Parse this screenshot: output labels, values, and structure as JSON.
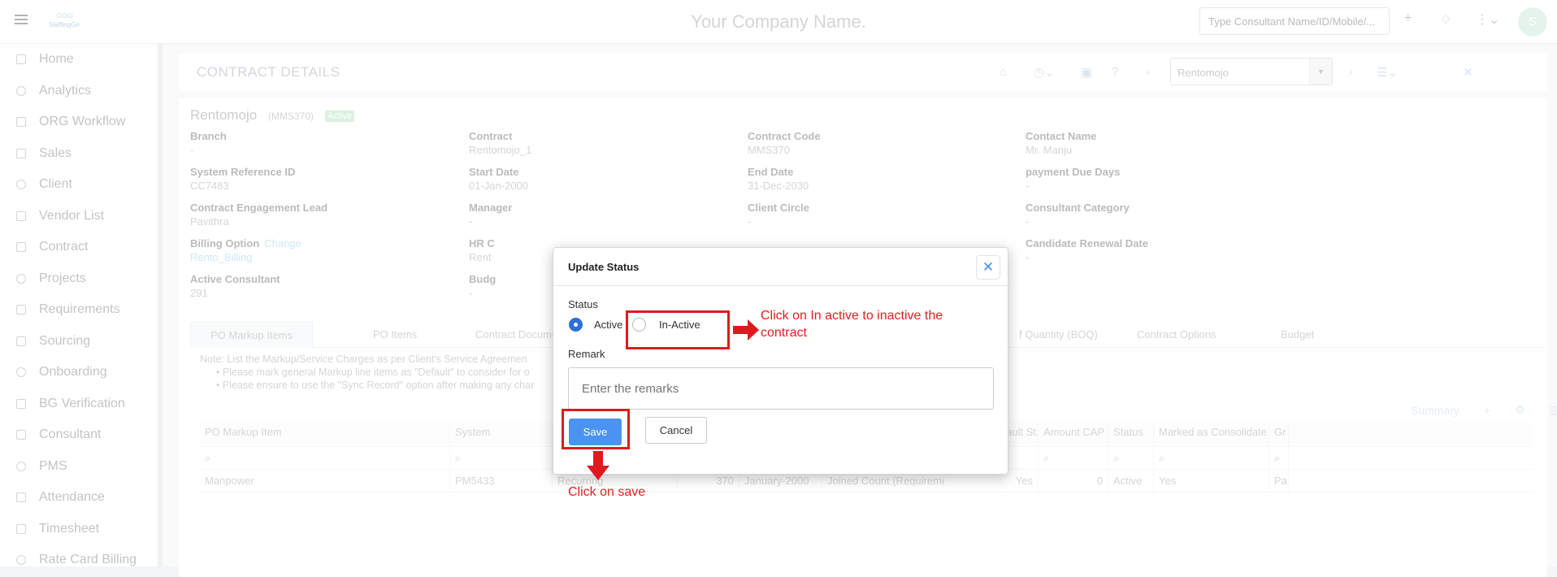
{
  "topbar": {
    "logo_text": "StaffingGo",
    "company_name": "Your Company Name.",
    "search_placeholder": "Type Consultant Name/ID/Mobile/...",
    "avatar_initial": "S"
  },
  "sidebar": {
    "items": [
      {
        "label": "Home",
        "icon": "home-icon"
      },
      {
        "label": "Analytics",
        "icon": "analytics-icon"
      },
      {
        "label": "ORG Workflow",
        "icon": "workflow-icon"
      },
      {
        "label": "Sales",
        "icon": "sales-icon"
      },
      {
        "label": "Client",
        "icon": "client-icon"
      },
      {
        "label": "Vendor List",
        "icon": "vendor-icon"
      },
      {
        "label": "Contract",
        "icon": "contract-icon"
      },
      {
        "label": "Projects",
        "icon": "projects-icon"
      },
      {
        "label": "Requirements",
        "icon": "requirements-icon"
      },
      {
        "label": "Sourcing",
        "icon": "sourcing-icon"
      },
      {
        "label": "Onboarding",
        "icon": "onboarding-icon"
      },
      {
        "label": "BG Verification",
        "icon": "verification-icon"
      },
      {
        "label": "Consultant",
        "icon": "consultant-icon"
      },
      {
        "label": "PMS",
        "icon": "pms-icon"
      },
      {
        "label": "Attendance",
        "icon": "calendar-icon"
      },
      {
        "label": "Timesheet",
        "icon": "clock-icon"
      },
      {
        "label": "Rate Card Billing",
        "icon": "rate-card-icon"
      }
    ]
  },
  "header": {
    "title": "CONTRACT DETAILS",
    "client_select": "Rentomojo"
  },
  "details": {
    "client_name": "Rentomojo",
    "client_code": "(MMS370)",
    "status_badge": "Active",
    "fields": {
      "branch": {
        "label": "Branch",
        "value": "-"
      },
      "contract": {
        "label": "Contract",
        "value": "Rentomojo_1"
      },
      "contract_code": {
        "label": "Contract Code",
        "value": "MMS370"
      },
      "contact_name": {
        "label": "Contact Name",
        "value": "Mr. Manju"
      },
      "system_ref": {
        "label": "System Reference ID",
        "value": "CC7483"
      },
      "start_date": {
        "label": "Start Date",
        "value": "01-Jan-2000"
      },
      "end_date": {
        "label": "End Date",
        "value": "31-Dec-2030"
      },
      "payment_due": {
        "label": "payment Due Days",
        "value": "-"
      },
      "engagement_lead": {
        "label": "Contract Engagement Lead",
        "value": "Pavithra"
      },
      "manager": {
        "label": "Manager",
        "value": "-"
      },
      "client_circle": {
        "label": "Client Circle",
        "value": "-"
      },
      "consultant_category": {
        "label": "Consultant Category",
        "value": "-"
      },
      "billing_option": {
        "label": "Billing Option",
        "change": "Change",
        "value": "Rento_Billing"
      },
      "hr": {
        "label": "HR C",
        "value": "Rent"
      },
      "renewal_date": {
        "label": "Candidate Renewal Date",
        "value": "-"
      },
      "active_consultant": {
        "label": "Active Consultant",
        "value": "291"
      },
      "budget": {
        "label": "Budg",
        "value": "-"
      }
    }
  },
  "tabs": [
    "PO Markup Items",
    "PO Items",
    "Contract Documen",
    "f Quantity (BOQ)",
    "Contract Options",
    "Budget"
  ],
  "note": {
    "line1": "Note: List the Markup/Service Charges as per Client's Service Agreemen",
    "line2": "Please mark general Markup line items as \"Default\" to consider for o",
    "line3": "Please ensure to use the \"Sync Record\" option after making any char"
  },
  "grid": {
    "summary_label": "Summary",
    "headers": [
      "PO Markup Item",
      "System",
      "",
      "",
      "",
      "e",
      "Mark as Default St...",
      "Amount CAP",
      "Status",
      "Marked as Consolidate",
      "Gr"
    ],
    "row": [
      "Manpower",
      "PM5433",
      "Recurring",
      "370",
      "January-2000",
      "Joined Count (Requirement)",
      "Yes",
      "0",
      "Active",
      "Yes",
      "Pa"
    ]
  },
  "modal": {
    "title": "Update Status",
    "status_label": "Status",
    "option_active": "Active",
    "option_inactive": "In-Active",
    "remark_label": "Remark",
    "remark_placeholder": "Enter the remarks",
    "save_label": "Save",
    "cancel_label": "Cancel",
    "close_symbol": "✕"
  },
  "annotations": {
    "inactive_hint_line1": "Click on In active to inactive the",
    "inactive_hint_line2": "contract",
    "save_hint": "Click on save"
  }
}
